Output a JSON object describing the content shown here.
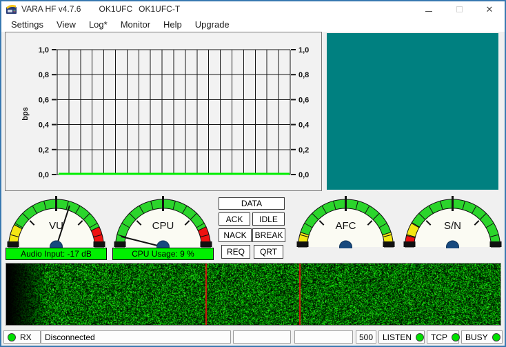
{
  "window": {
    "title": "VARA HF v4.7.6",
    "callsign_1": "OK1UFC",
    "callsign_2": "OK1UFC-T",
    "border_color": "#3878b0"
  },
  "menu": {
    "items": [
      "Settings",
      "View",
      "Log*",
      "Monitor",
      "Help",
      "Upgrade"
    ]
  },
  "chart_data": {
    "type": "line",
    "title": "",
    "ylabel": "bps",
    "xlabel": "",
    "ylim": [
      0,
      1
    ],
    "yticks": [
      "1,0",
      "0,8",
      "0,6",
      "0,4",
      "0,2",
      "0,0"
    ],
    "x_divisions": 20,
    "grid": true,
    "series": [
      {
        "name": "bps",
        "color": "#00ee00",
        "values": [
          0,
          0,
          0,
          0,
          0,
          0,
          0,
          0,
          0,
          0,
          0,
          0,
          0,
          0,
          0,
          0,
          0,
          0,
          0,
          0,
          0
        ]
      }
    ]
  },
  "constellation": {
    "color": "#008080"
  },
  "gauges": [
    {
      "id": "vu",
      "label": "VU",
      "bar_text": "Audio Input: -17 dB",
      "needle_deg": 72,
      "segments": [
        [
          180,
          152,
          "#f3e713"
        ],
        [
          152,
          25,
          "#2bd52b"
        ],
        [
          25,
          0,
          "#ee1111"
        ]
      ]
    },
    {
      "id": "cpu",
      "label": "CPU",
      "bar_text": "CPU Usage: 9 %",
      "needle_deg": 166,
      "segments": [
        [
          180,
          25,
          "#2bd52b"
        ],
        [
          25,
          0,
          "#ee1111"
        ]
      ]
    },
    {
      "id": "afc",
      "label": "AFC",
      "bar_text": null,
      "needle_deg": null,
      "segments": [
        [
          180,
          162,
          "#f3e713"
        ],
        [
          162,
          18,
          "#2bd52b"
        ],
        [
          18,
          0,
          "#f3e713"
        ]
      ]
    },
    {
      "id": "sn",
      "label": "S/N",
      "bar_text": null,
      "needle_deg": null,
      "segments": [
        [
          180,
          166,
          "#ee1111"
        ],
        [
          166,
          149,
          "#f3e713"
        ],
        [
          149,
          0,
          "#2bd52b"
        ]
      ]
    }
  ],
  "indicators": {
    "data": "DATA",
    "ack": "ACK",
    "idle": "IDLE",
    "nack": "NACK",
    "break": "BREAK",
    "req": "REQ",
    "qrt": "QRT"
  },
  "waterfall": {
    "markers": [
      0.405,
      0.594
    ],
    "marker_color": "#e01010"
  },
  "statusbar": {
    "rx_label": "RX",
    "connection_status": "Disconnected",
    "bandwidth": "500",
    "listen_label": "LISTEN",
    "tcp_label": "TCP",
    "busy_label": "BUSY",
    "led_color": "#00e000"
  }
}
